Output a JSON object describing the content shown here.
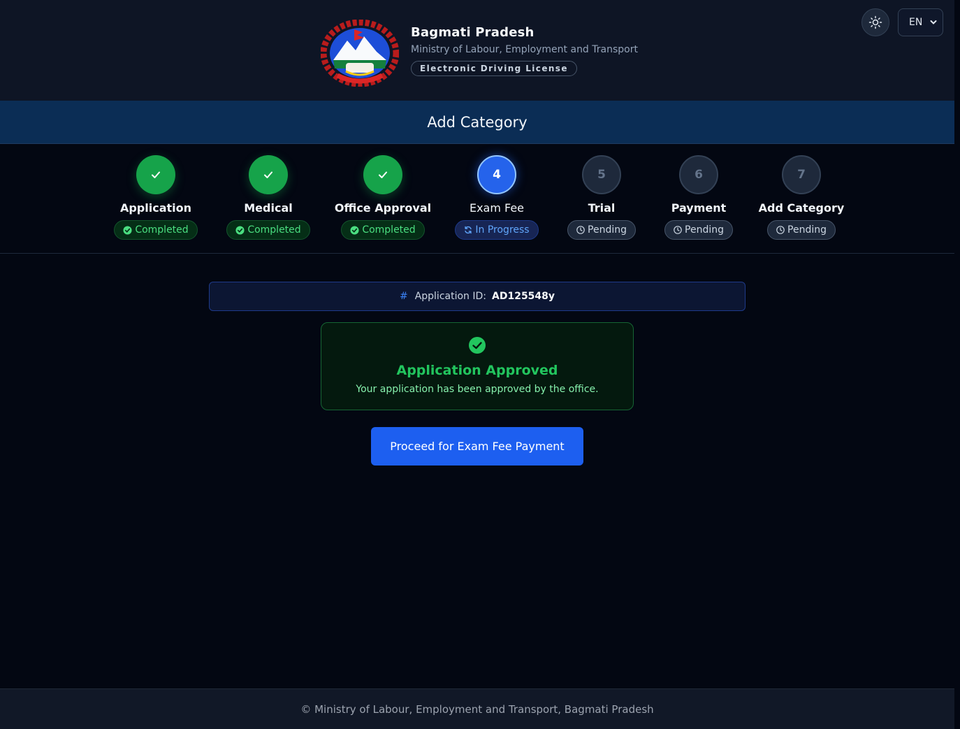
{
  "header": {
    "title": "Bagmati Pradesh",
    "subtitle": "Ministry of Labour, Employment and Transport",
    "badge": "Electronic Driving License",
    "language": "EN"
  },
  "page": {
    "title": "Add Category"
  },
  "steps": [
    {
      "number": "1",
      "label": "Application",
      "status": "Completed",
      "state": "done"
    },
    {
      "number": "2",
      "label": "Medical",
      "status": "Completed",
      "state": "done"
    },
    {
      "number": "3",
      "label": "Office Approval",
      "status": "Completed",
      "state": "done"
    },
    {
      "number": "4",
      "label": "Exam Fee",
      "status": "In Progress",
      "state": "active"
    },
    {
      "number": "5",
      "label": "Trial",
      "status": "Pending",
      "state": "pending"
    },
    {
      "number": "6",
      "label": "Payment",
      "status": "Pending",
      "state": "pending"
    },
    {
      "number": "7",
      "label": "Add Category",
      "status": "Pending",
      "state": "pending"
    }
  ],
  "application": {
    "id_label": "Application ID:",
    "id_value": "AD125548y"
  },
  "approval": {
    "title": "Application Approved",
    "message": "Your application has been approved by the office."
  },
  "actions": {
    "proceed_label": "Proceed for Exam Fee Payment"
  },
  "footer": {
    "text": "© Ministry of Labour, Employment and Transport, Bagmati Pradesh"
  },
  "colors": {
    "success": "#22c55e",
    "primary": "#1d5ff0",
    "banner": "#0b2d55"
  }
}
